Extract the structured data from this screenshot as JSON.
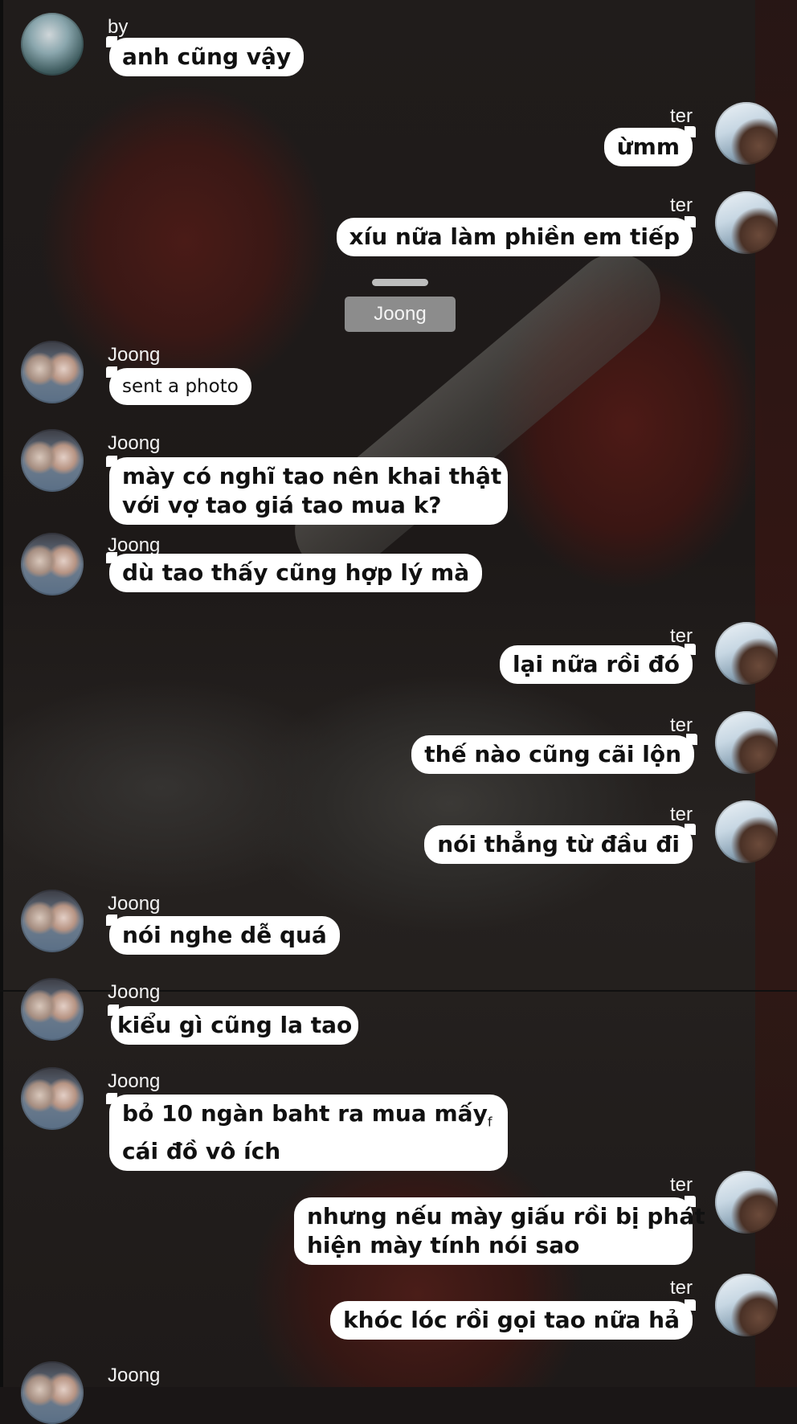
{
  "participants": {
    "by": "by",
    "ter": "ter",
    "joong": "Joong"
  },
  "section_label": "Joong",
  "messages": [
    {
      "sender": "by",
      "text": "anh cũng vậy"
    },
    {
      "sender": "ter",
      "text": "ừmm"
    },
    {
      "sender": "ter",
      "text": "xíu nữa làm phiền em tiếp"
    },
    {
      "sender": "Joong",
      "text": "sent a photo"
    },
    {
      "sender": "Joong",
      "text": "mày có nghĩ tao nên khai thật",
      "text2": "với vợ tao giá tao mua k?"
    },
    {
      "sender": "Joong",
      "text": "dù tao thấy cũng hợp lý mà"
    },
    {
      "sender": "ter",
      "text": "lại nữa rồi đó"
    },
    {
      "sender": "ter",
      "text": "thế nào cũng cãi lộn"
    },
    {
      "sender": "ter",
      "text": "nói thẳng từ đầu đi"
    },
    {
      "sender": "Joong",
      "text": "nói nghe dễ quá"
    },
    {
      "sender": "Joong",
      "text": "kiểu gì cũng la tao"
    },
    {
      "sender": "Joong",
      "text": "bỏ 10 ngàn baht ra mua mấy",
      "extra": "f",
      "text2": "cái đồ vô ích"
    },
    {
      "sender": "ter",
      "text": "nhưng nếu mày giấu rồi bị phát",
      "text2": "hiện mày tính nói sao"
    },
    {
      "sender": "ter",
      "text": "khóc lóc rồi gọi tao nữa hả"
    },
    {
      "sender": "Joong",
      "text": ""
    }
  ]
}
